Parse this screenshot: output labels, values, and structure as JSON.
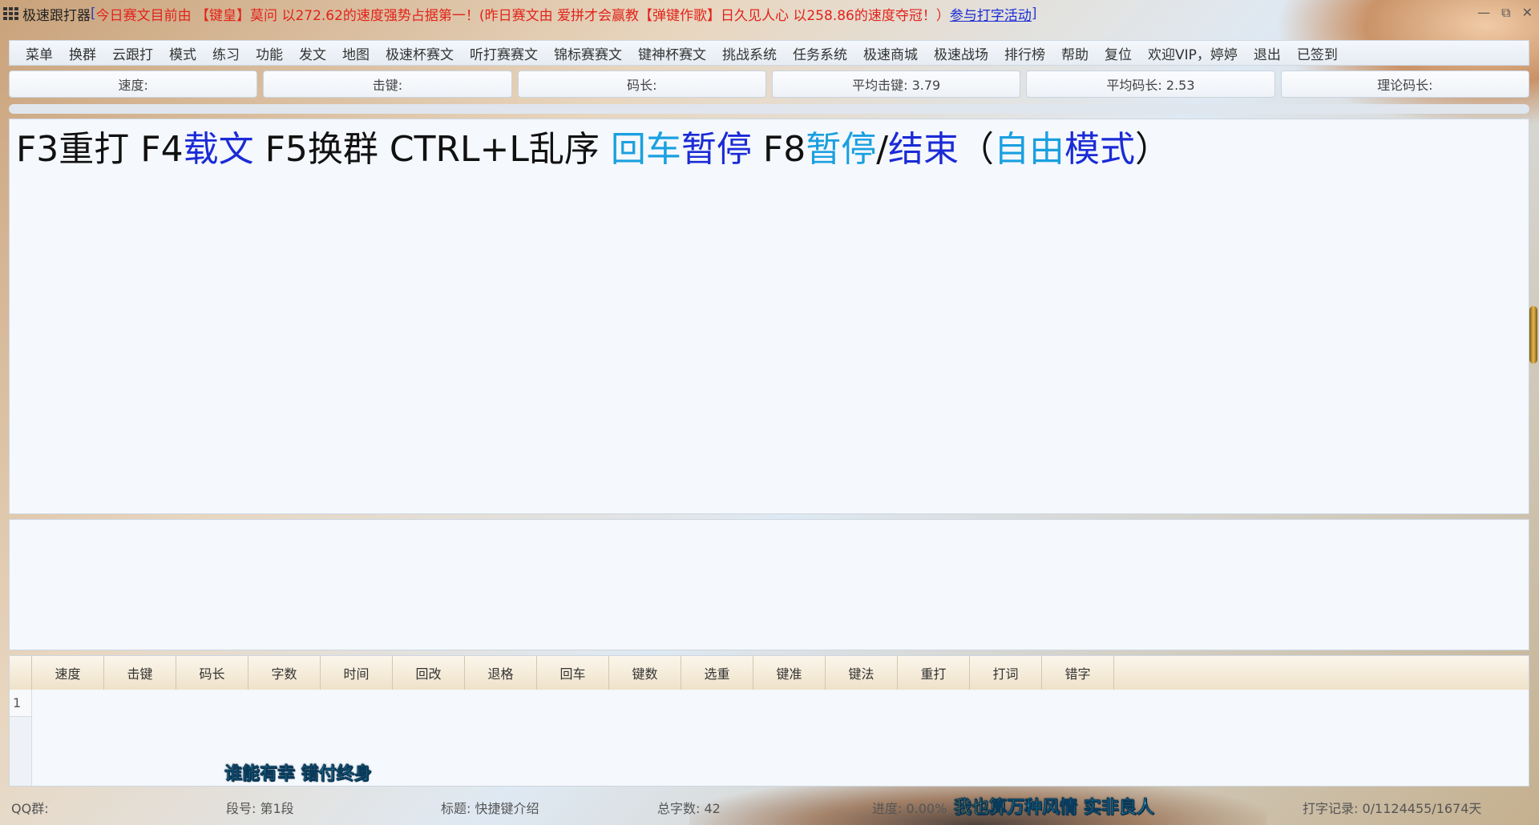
{
  "titlebar": {
    "app_title": "极速跟打器",
    "bracket_open": "[",
    "notice": "今日赛文目前由 【键皇】莫问 以272.62的速度强势占据第一！(昨日赛文由 爱拼才会赢教【弹键作歌】日久见人心 以258.86的速度夺冠！）",
    "notice_link": "参与打字活动",
    "bracket_close": "]",
    "controls": [
      "—",
      "⧉",
      "✕"
    ]
  },
  "menu": {
    "items": [
      "菜单",
      "换群",
      "云跟打",
      "模式",
      "练习",
      "功能",
      "发文",
      "地图",
      "极速杯赛文",
      "听打赛赛文",
      "锦标赛赛文",
      "键神杯赛文",
      "挑战系统",
      "任务系统",
      "极速商城",
      "极速战场",
      "排行榜",
      "帮助",
      "复位",
      "欢迎VIP，婷婷",
      "退出",
      "已签到"
    ]
  },
  "stats": {
    "speed": "速度:",
    "keystroke": "击键:",
    "code_length": "码长:",
    "avg_keystroke": "平均击键: 3.79",
    "avg_code_length": "平均码长: 2.53",
    "theory_code_length": "理论码长:"
  },
  "progress": {
    "percent": 0
  },
  "main_text": {
    "segments": [
      {
        "text": "F3重打 F4",
        "style": "plain"
      },
      {
        "text": "载文",
        "style": "blue"
      },
      {
        "text": " F5换群 CTRL+L乱序 ",
        "style": "plain"
      },
      {
        "text": "回车",
        "style": "cyan"
      },
      {
        "text": "暂停",
        "style": "blue"
      },
      {
        "text": " F8",
        "style": "plain"
      },
      {
        "text": "暂停",
        "style": "cyan"
      },
      {
        "text": "/",
        "style": "plain"
      },
      {
        "text": "结束",
        "style": "blue"
      },
      {
        "text": "（",
        "style": "plain"
      },
      {
        "text": "自由",
        "style": "cyan"
      },
      {
        "text": "模式",
        "style": "blue"
      },
      {
        "text": "）",
        "style": "plain"
      }
    ]
  },
  "result_table": {
    "headers": [
      "速度",
      "击键",
      "码长",
      "字数",
      "时间",
      "回改",
      "退格",
      "回车",
      "键数",
      "选重",
      "键准",
      "键法",
      "重打",
      "打词",
      "错字"
    ],
    "row_number": "1"
  },
  "lyrics": {
    "left": "谁能有幸  错付终身",
    "right_yellow": "我也算",
    "right_cyan_1": "万种风情",
    "right_gap": " ",
    "right_cyan_2": "实非良人"
  },
  "status": {
    "qq_group": "QQ群:",
    "segment": "段号: 第1段",
    "title": "标题: 快捷键介绍",
    "total_chars": "总字数: 42",
    "progress_text": "进度: 0.00%",
    "record": "打字记录: 0/1124455/1674天"
  },
  "colors": {
    "notice_red": "#e2231a",
    "link_blue": "#1a2bd6",
    "keyword_blue": "#1a2bd6",
    "keyword_cyan": "#1aa0e0"
  }
}
